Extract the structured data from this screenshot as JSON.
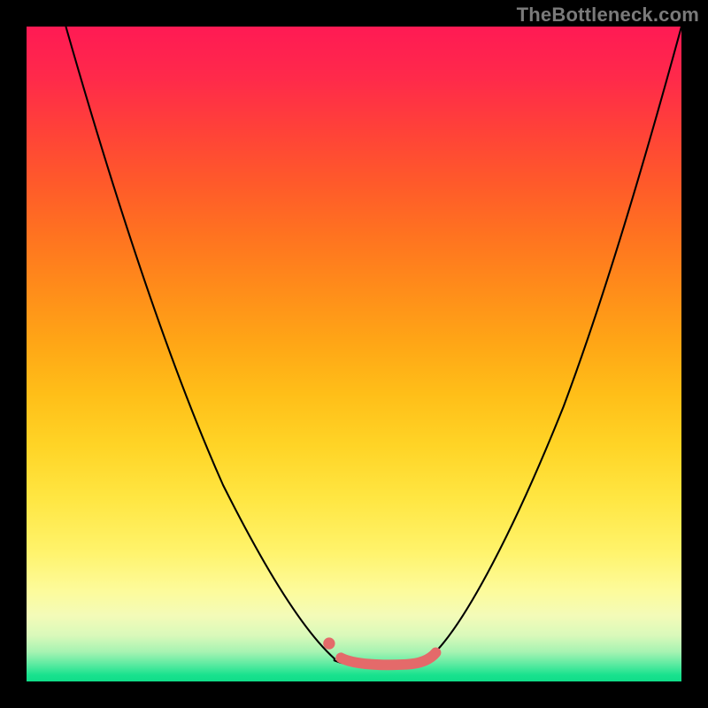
{
  "watermark": "TheBottleneck.com",
  "colors": {
    "curve": "#000000",
    "marker": "#e46a6a",
    "frame": "#000000",
    "gradient_top": "#ff1a54",
    "gradient_mid": "#ffd426",
    "gradient_bottom": "#0fdd89"
  },
  "chart_data": {
    "type": "line",
    "title": "",
    "xlabel": "",
    "ylabel": "",
    "xlim": [
      0,
      100
    ],
    "ylim": [
      0,
      100
    ],
    "note": "Axes are unlabeled; values below are normalized 0–100 estimates read from the rendered curve (x = horizontal position within plot, y = bottleneck metric where 0 = bottom/green/good, 100 = top/red/bad).",
    "series": [
      {
        "name": "bottleneck-curve",
        "x": [
          6,
          12,
          18,
          24,
          30,
          36,
          42,
          47,
          50,
          54,
          58,
          61,
          66,
          74,
          82,
          88,
          94,
          100
        ],
        "y": [
          100,
          79,
          60,
          44,
          30,
          18,
          8,
          3.5,
          2.5,
          2.4,
          2.5,
          3.2,
          7,
          22,
          42,
          58,
          78,
          100
        ]
      }
    ],
    "markers": [
      {
        "name": "left-dot",
        "x": 46.2,
        "y": 5.8,
        "shape": "circle",
        "color": "#e46a6a"
      },
      {
        "name": "valley-segment",
        "x_start": 48,
        "x_end": 62.5,
        "y_approx": 3,
        "shape": "thick-line",
        "color": "#e46a6a"
      }
    ],
    "background_gradient": {
      "direction": "vertical",
      "meaning": "top=red=high bottleneck, bottom=green=low bottleneck",
      "stops": [
        {
          "pos": 0.0,
          "color": "#ff1a54"
        },
        {
          "pos": 0.5,
          "color": "#ffa516"
        },
        {
          "pos": 0.8,
          "color": "#fff36a"
        },
        {
          "pos": 1.0,
          "color": "#0fdd89"
        }
      ]
    }
  }
}
